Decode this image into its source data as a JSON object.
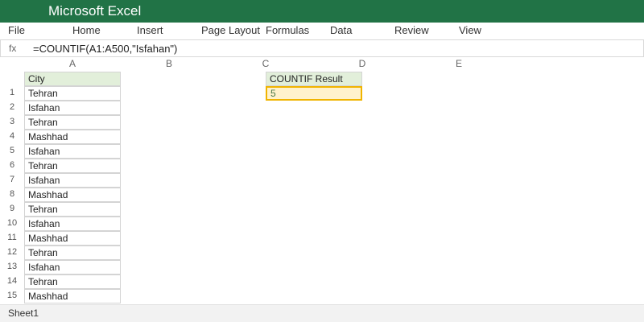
{
  "app": {
    "title": "Microsoft Excel"
  },
  "ribbon": {
    "tabs": [
      "File",
      "Home",
      "Insert",
      "Page Layout",
      "Formulas",
      "Data",
      "Review",
      "View"
    ]
  },
  "formula_bar": {
    "fx_label": "fx",
    "formula": "=COUNTIF(A1:A500,\"Isfahan\")"
  },
  "sheet": {
    "column_headers": [
      "A",
      "B",
      "C",
      "D",
      "E"
    ],
    "row_numbers": [
      "1",
      "2",
      "3",
      "4",
      "5",
      "6",
      "7",
      "8",
      "9",
      "10",
      "11",
      "12",
      "13",
      "14",
      "15"
    ],
    "city_header": "City",
    "cities": [
      "Tehran",
      "Isfahan",
      "Tehran",
      "Mashhad",
      "Isfahan",
      "Tehran",
      "Isfahan",
      "Mashhad",
      "Tehran",
      "Isfahan",
      "Mashhad",
      "Tehran",
      "Isfahan",
      "Tehran",
      "Mashhad"
    ],
    "result_header": "COUNTIF Result",
    "result_value": "5"
  },
  "status": {
    "sheet_tab": "Sheet1"
  },
  "colors": {
    "brand": "#217346",
    "header_fill": "#e2efda",
    "result_fill": "#fff2cc",
    "result_border": "#f0b400"
  }
}
